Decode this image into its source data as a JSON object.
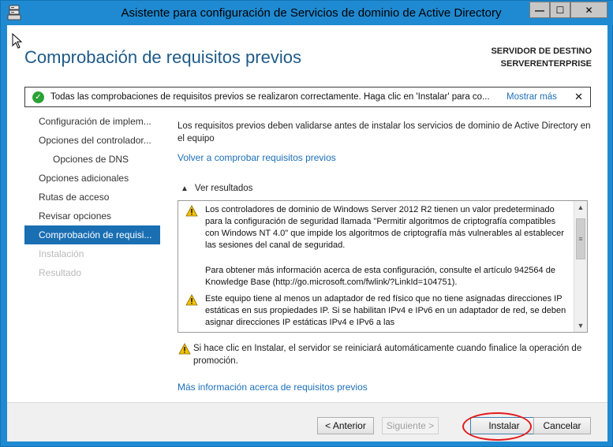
{
  "window": {
    "title": "Asistente para configuración de Servicios de dominio de Active Directory",
    "min_label": "—",
    "max_label": "☐",
    "close_label": "✕"
  },
  "header": {
    "title": "Comprobación de requisitos previos",
    "server_label": "SERVIDOR DE DESTINO",
    "server_name": "SERVERENTERPRISE"
  },
  "notice": {
    "text": "Todas las comprobaciones de requisitos previos se realizaron correctamente. Haga clic en 'Instalar' para co...",
    "link": "Mostrar más",
    "close": "✕"
  },
  "nav": {
    "items": [
      {
        "label": "Configuración de implem..."
      },
      {
        "label": "Opciones del controlador..."
      },
      {
        "label": "Opciones de DNS"
      },
      {
        "label": "Opciones adicionales"
      },
      {
        "label": "Rutas de acceso"
      },
      {
        "label": "Revisar opciones"
      },
      {
        "label": "Comprobación de requisi..."
      },
      {
        "label": "Instalación"
      },
      {
        "label": "Resultado"
      }
    ]
  },
  "main": {
    "intro": "Los requisitos previos deben validarse antes de instalar los servicios de dominio de Active Directory en el equipo",
    "recheck_link": "Volver a comprobar requisitos previos",
    "results_toggle": "Ver resultados",
    "results": [
      {
        "text": "Los controladores de dominio de Windows Server 2012 R2 tienen un valor predeterminado para la configuración de seguridad llamada \"Permitir algoritmos de criptografía compatibles con Windows NT 4.0\" que impide los algoritmos de criptografía más vulnerables al establecer las sesiones del canal de seguridad."
      },
      {
        "text": "Para obtener más información acerca de esta configuración, consulte el artículo 942564 de Knowledge Base (http://go.microsoft.com/fwlink/?LinkId=104751)."
      },
      {
        "text": "Este equipo tiene al menos un adaptador de red físico que no tiene asignadas direcciones IP estáticas en sus propiedades IP. Si se habilitan IPv4 e IPv6 en un adaptador de red, se deben asignar direcciones IP estáticas IPv4 e IPv6 a las"
      }
    ],
    "restart_warning": "Si hace clic en Instalar, el servidor se reiniciará automáticamente cuando finalice la operación de promoción.",
    "more_info_link": "Más información acerca de requisitos previos"
  },
  "footer": {
    "prev": "< Anterior",
    "next": "Siguiente >",
    "install": "Instalar",
    "cancel": "Cancelar"
  },
  "colors": {
    "title_bar": "#1f8ad2",
    "header_title": "#1e5a88",
    "nav_active": "#1a6fb3",
    "link": "#1d6fb8",
    "ok": "#2aa238",
    "warning": "#f2c200",
    "highlight": "#e2191b"
  }
}
